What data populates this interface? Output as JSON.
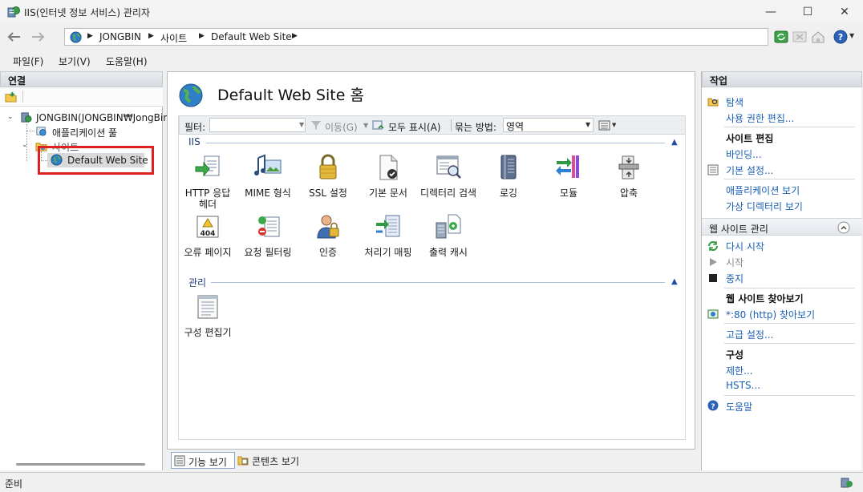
{
  "window": {
    "title": "IIS(인터넷 정보 서비스) 관리자",
    "minimize_glyph": "—",
    "maximize_glyph": "☐",
    "close_glyph": "✕"
  },
  "address": {
    "crumbs": [
      "JONGBIN",
      "사이트",
      "Default Web Site"
    ]
  },
  "menu": {
    "items": [
      "파일(F)",
      "보기(V)",
      "도움말(H)"
    ]
  },
  "connections": {
    "header": "연결",
    "tree": {
      "server": "JONGBIN(JONGBIN₩JongBin)",
      "app_pools": "애플리케이션 풀",
      "sites": "사이트",
      "site": "Default Web Site"
    }
  },
  "main": {
    "heading": "Default Web Site 홈",
    "filter": {
      "label": "필터:",
      "value": "",
      "go_label": "이동(G)",
      "show_all_label": "모두 표시(A)",
      "group_by_label": "묶는 방법:",
      "group_by_value": "영역"
    },
    "groups": [
      {
        "name": "IIS",
        "features": [
          {
            "label": "HTTP 응답 헤더",
            "icon": "http-response-headers-icon"
          },
          {
            "label": "MIME 형식",
            "icon": "mime-types-icon"
          },
          {
            "label": "SSL 설정",
            "icon": "ssl-lock-icon"
          },
          {
            "label": "기본 문서",
            "icon": "default-document-icon"
          },
          {
            "label": "디렉터리 검색",
            "icon": "directory-browsing-icon"
          },
          {
            "label": "로깅",
            "icon": "logging-book-icon"
          },
          {
            "label": "모듈",
            "icon": "modules-icon"
          },
          {
            "label": "압축",
            "icon": "compression-icon"
          },
          {
            "label": "오류 페이지",
            "icon": "error-pages-404-icon"
          },
          {
            "label": "요청 필터링",
            "icon": "request-filtering-icon"
          },
          {
            "label": "인증",
            "icon": "authentication-user-icon"
          },
          {
            "label": "처리기 매핑",
            "icon": "handler-mappings-icon"
          },
          {
            "label": "출력 캐시",
            "icon": "output-cache-icon"
          }
        ]
      },
      {
        "name": "관리",
        "features": [
          {
            "label": "구성 편집기",
            "icon": "configuration-editor-icon"
          }
        ]
      }
    ],
    "view_tabs": [
      "기능 보기",
      "콘텐츠 보기"
    ]
  },
  "actions": {
    "header": "작업",
    "explore": "탐색",
    "edit_permissions": "사용 권한 편집...",
    "edit_site_heading": "사이트 편집",
    "bindings": "바인딩...",
    "basic_settings": "기본 설정...",
    "view_applications": "애플리케이션 보기",
    "view_virtual_dirs": "가상 디렉터리 보기",
    "manage_heading": "웹 사이트 관리",
    "restart": "다시 시작",
    "start": "시작",
    "stop": "중지",
    "browse_heading": "웹 사이트 찾아보기",
    "browse_80": "*:80 (http) 찾아보기",
    "advanced_settings": "고급 설정...",
    "config_heading": "구성",
    "limits": "제한...",
    "hsts": "HSTS...",
    "help": "도움말"
  },
  "status": {
    "text": "준비"
  },
  "colors": {
    "link": "#1a5fb4",
    "highlight_box": "#e02020",
    "group_line": "#a9bdd8"
  }
}
